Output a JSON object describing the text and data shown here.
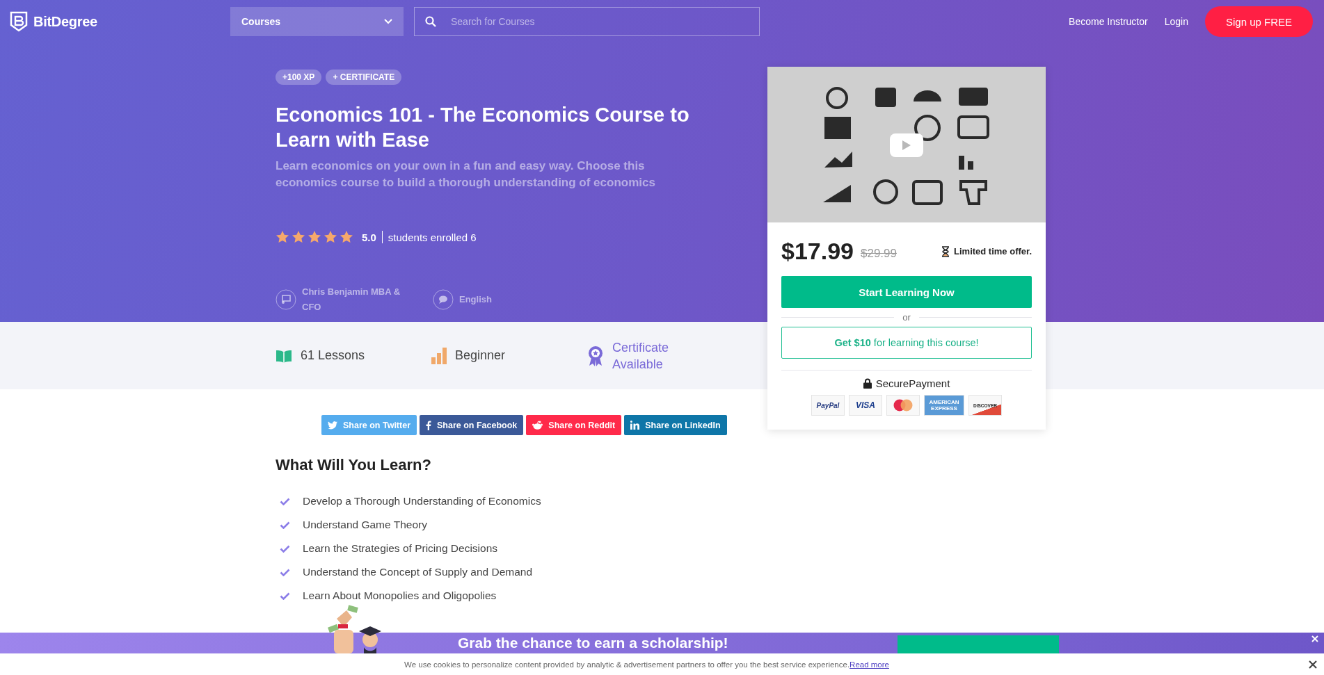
{
  "header": {
    "logo": "BitDegree",
    "category_select": {
      "value": "Courses"
    },
    "search": {
      "placeholder": "Search for Courses"
    },
    "links": [
      "Become Instructor",
      "Login"
    ],
    "signup": "Sign up FREE"
  },
  "course": {
    "badges": [
      "+100 XP",
      "+ CERTIFICATE"
    ],
    "title": "Economics 101 - The Economics Course to Learn with Ease",
    "subtitle": "Learn economics on your own in a fun and easy way. Choose this economics course to build a thorough understanding of economics",
    "stars": 5,
    "rating": "5.0",
    "enrolled": "students enrolled 6",
    "author": "Chris Benjamin MBA & CFO",
    "language": "English"
  },
  "stats": [
    {
      "kind": "lessons",
      "label": "61 Lessons"
    },
    {
      "kind": "level",
      "label": "Beginner"
    },
    {
      "kind": "certificate",
      "label": "Certificate Available"
    }
  ],
  "purchase_card": {
    "price": "$17.99",
    "old_price": "$29.99",
    "offer": "Limited time offer.",
    "primary_button": "Start Learning Now",
    "divider": "or",
    "secondary_button": "**Get $10** for learning this course!",
    "secure": "SecurePayment",
    "payment_methods": [
      {
        "kind": "paypal",
        "label": "PayPal"
      },
      {
        "kind": "visa",
        "label": "VISA"
      },
      {
        "kind": "mastercard"
      },
      {
        "kind": "amex",
        "label": "AMERICAN EXPRESS"
      },
      {
        "kind": "discover",
        "label": "DISCOVER"
      }
    ]
  },
  "share_buttons": [
    {
      "kind": "twitter",
      "label": "Share on Twitter",
      "color": "#55acee"
    },
    {
      "kind": "facebook",
      "label": "Share on Facebook",
      "color": "#3b5998"
    },
    {
      "kind": "reddit",
      "label": "Share on Reddit",
      "color": "#ff2a4a"
    },
    {
      "kind": "linkedin",
      "label": "Share on LinkedIn",
      "color": "#0e76a8"
    }
  ],
  "learn": {
    "heading": "What Will You Learn?",
    "items": [
      "Develop a Thorough Understanding of Economics",
      "Understand Game Theory",
      "Learn the Strategies of Pricing Decisions",
      "Understand the Concept of Supply and Demand",
      "Learn About Monopolies and Oligopolies"
    ]
  },
  "scholarship_banner": {
    "text": "Grab the chance to earn a scholarship!"
  },
  "cookie_bar": {
    "text": "We use cookies to personalize content provided by analytic & advertisement partners to offer you the best service experience.",
    "link": "Read more"
  }
}
